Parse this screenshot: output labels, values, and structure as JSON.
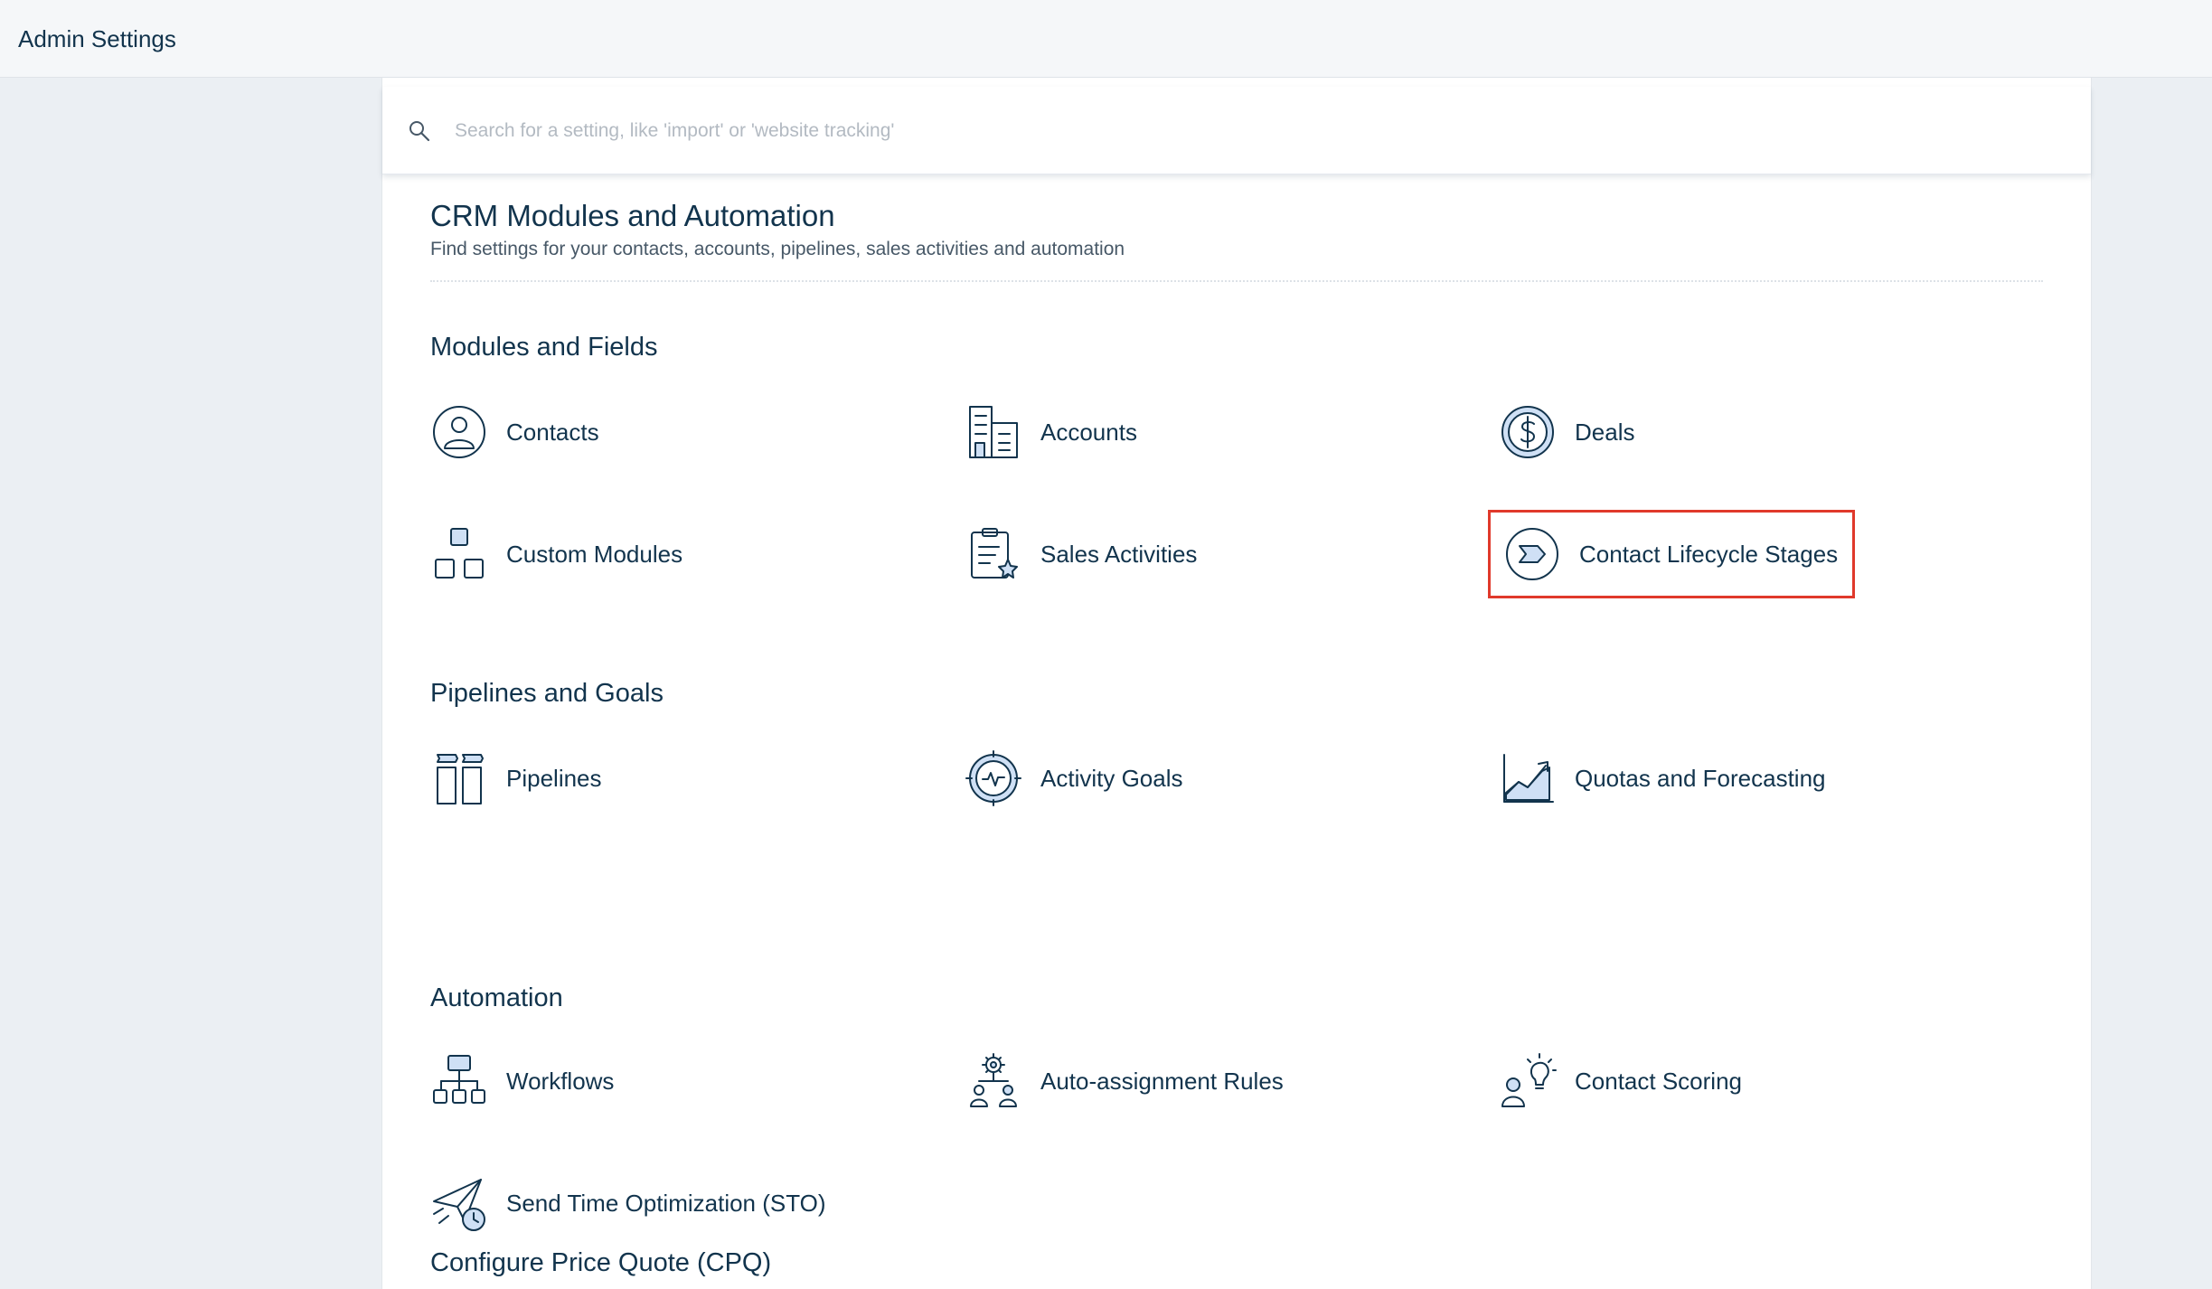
{
  "header": {
    "title": "Admin Settings"
  },
  "search": {
    "placeholder": "Search for a setting, like 'import' or 'website tracking'"
  },
  "page": {
    "title": "CRM Modules and Automation",
    "subtitle": "Find settings for your contacts, accounts, pipelines, sales activities and automation"
  },
  "groups": {
    "modules": {
      "title": "Modules and Fields",
      "items": [
        "Contacts",
        "Accounts",
        "Deals",
        "Custom Modules",
        "Sales Activities",
        "Contact Lifecycle Stages"
      ]
    },
    "pipelines": {
      "title": "Pipelines and Goals",
      "items": [
        "Pipelines",
        "Activity Goals",
        "Quotas and Forecasting"
      ]
    },
    "automation": {
      "title": "Automation",
      "items": [
        "Workflows",
        "Auto-assignment Rules",
        "Contact Scoring",
        "Send Time Optimization (STO)"
      ]
    },
    "cpq": {
      "title": "Configure Price Quote (CPQ)"
    }
  },
  "icons": {
    "contacts": "user-circle-icon",
    "accounts": "building-icon",
    "deals": "dollar-coin-icon",
    "custom_modules": "blocks-icon",
    "sales_activities": "clipboard-star-icon",
    "lifecycle": "chevron-stage-icon",
    "pipelines": "columns-icon",
    "activity_goals": "target-pulse-icon",
    "quotas": "trend-chart-icon",
    "workflows": "org-chart-icon",
    "auto_assignment": "gear-people-icon",
    "contact_scoring": "person-bulb-icon",
    "sto": "paper-plane-clock-icon"
  },
  "colors": {
    "accent": "#12344d",
    "icon_fill": "#cfe0f5",
    "highlight": "#e0392b"
  }
}
